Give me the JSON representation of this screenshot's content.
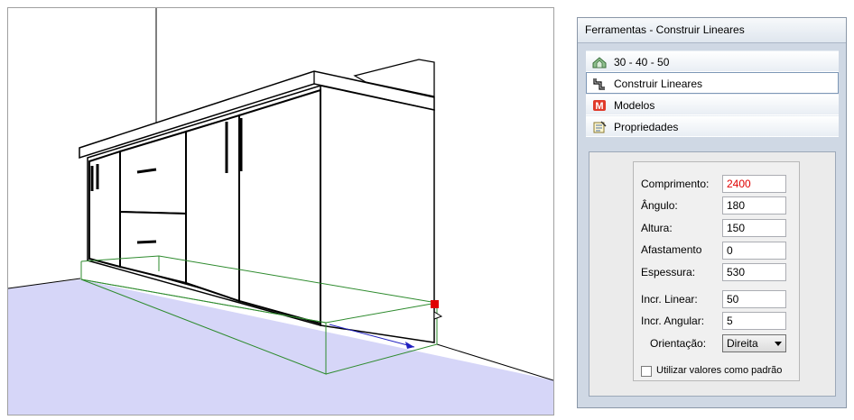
{
  "panel": {
    "title": "Ferramentas - Construir Lineares",
    "menu": [
      {
        "label": "30 - 40 - 50",
        "icon": "house-icon"
      },
      {
        "label": "Construir Lineares",
        "icon": "linear-path-icon",
        "active": true
      },
      {
        "label": "Modelos",
        "icon": "models-m-icon"
      },
      {
        "label": "Propriedades",
        "icon": "properties-icon"
      }
    ]
  },
  "form": {
    "comprimento": {
      "label": "Comprimento:",
      "value": "2400"
    },
    "angulo": {
      "label": "Ângulo:",
      "value": "180"
    },
    "altura": {
      "label": "Altura:",
      "value": "150"
    },
    "afastamento": {
      "label": "Afastamento",
      "value": "0"
    },
    "espessura": {
      "label": "Espessura:",
      "value": "530"
    },
    "incr_linear": {
      "label": "Incr. Linear:",
      "value": "50"
    },
    "incr_angular": {
      "label": "Incr. Angular:",
      "value": "5"
    },
    "orientacao": {
      "label": "Orientação:",
      "value": "Direita"
    },
    "default_checkbox": {
      "label": "Utilizar valores como padrão",
      "checked": false
    }
  },
  "colors": {
    "floor": "#d6d6f8",
    "bounding_box": "#2e8b2e",
    "handle_marker": "#e00000",
    "axis_arrow": "#2020c0"
  }
}
